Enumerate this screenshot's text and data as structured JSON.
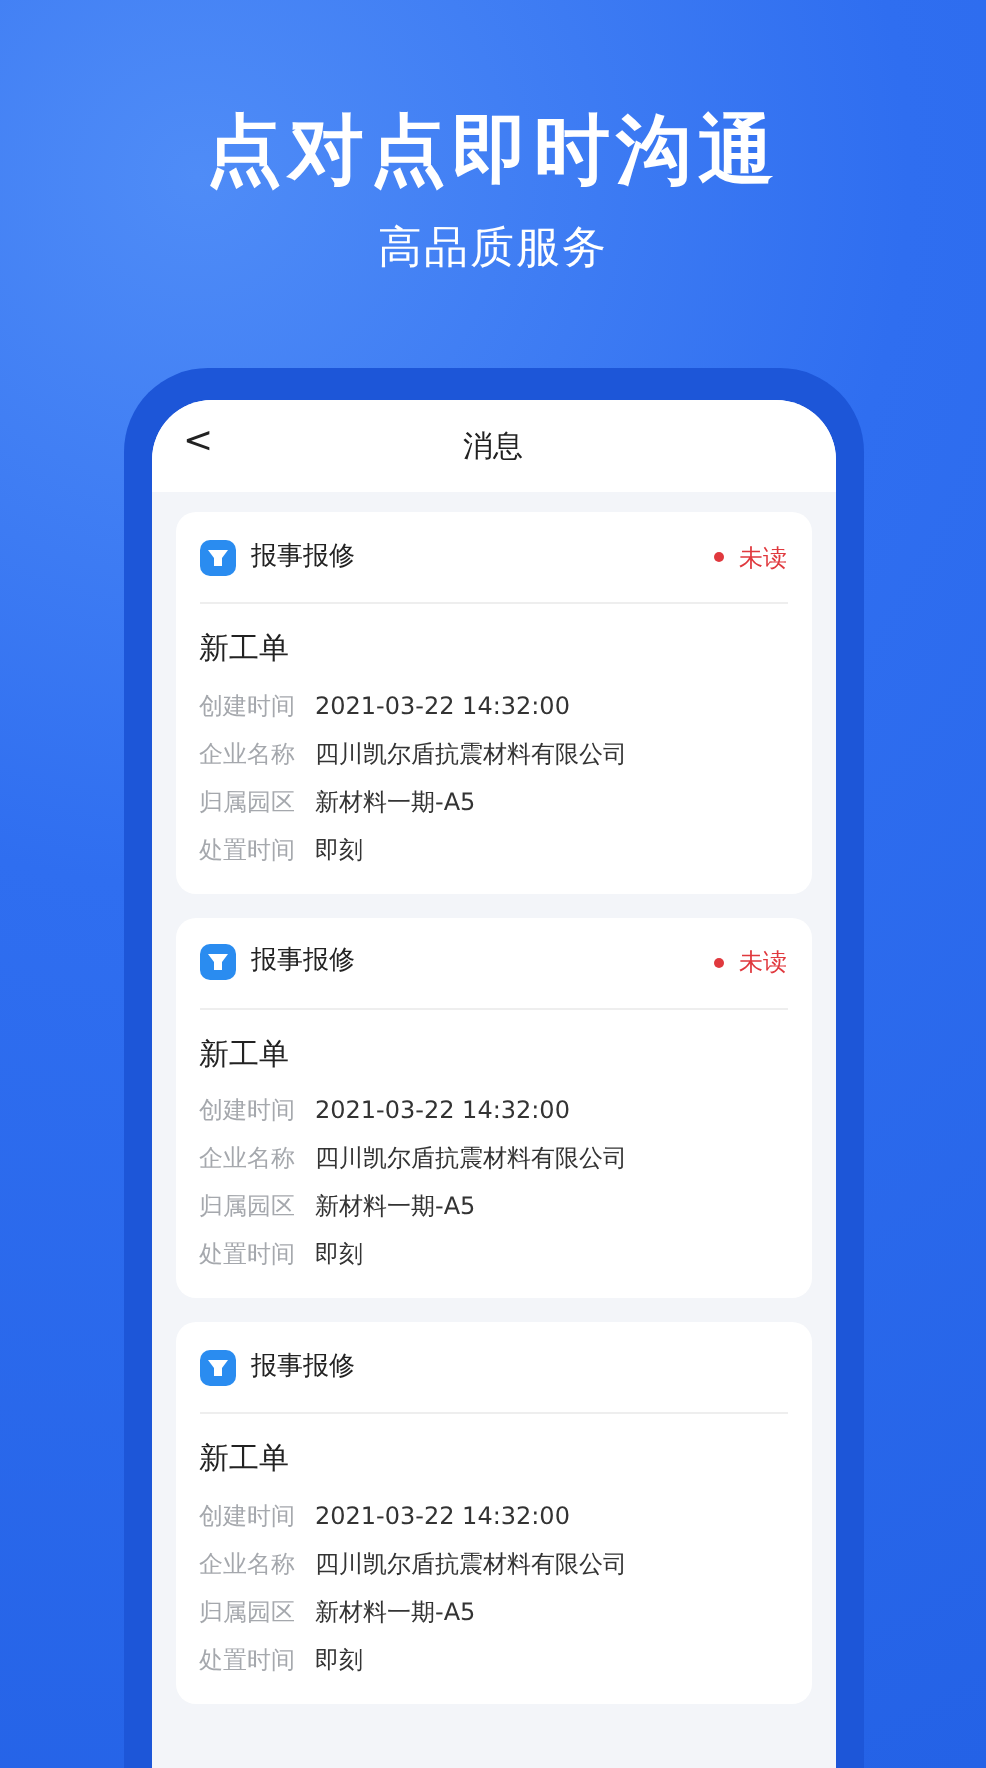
{
  "headline": "点对点即时沟通",
  "subheadline": "高品质服务",
  "screen": {
    "title": "消息",
    "back_icon": "<"
  },
  "messages": [
    {
      "category": "报事报修",
      "unread": true,
      "status": "未读",
      "title": "新工单",
      "fields": [
        {
          "label": "创建时间",
          "value": "2021-03-22 14:32:00"
        },
        {
          "label": "企业名称",
          "value": "四川凯尔盾抗震材料有限公司"
        },
        {
          "label": "归属园区",
          "value": "新材料一期-A5"
        },
        {
          "label": "处置时间",
          "value": "即刻"
        }
      ]
    },
    {
      "category": "报事报修",
      "unread": true,
      "status": "未读",
      "title": "新工单",
      "fields": [
        {
          "label": "创建时间",
          "value": "2021-03-22 14:32:00"
        },
        {
          "label": "企业名称",
          "value": "四川凯尔盾抗震材料有限公司"
        },
        {
          "label": "归属园区",
          "value": "新材料一期-A5"
        },
        {
          "label": "处置时间",
          "value": "即刻"
        }
      ]
    },
    {
      "category": "报事报修",
      "unread": false,
      "title": "新工单",
      "fields": [
        {
          "label": "创建时间",
          "value": "2021-03-22 14:32:00"
        },
        {
          "label": "企业名称",
          "value": "四川凯尔盾抗震材料有限公司"
        },
        {
          "label": "归属园区",
          "value": "新材料一期-A5"
        },
        {
          "label": "处置时间",
          "value": "即刻"
        }
      ]
    }
  ]
}
